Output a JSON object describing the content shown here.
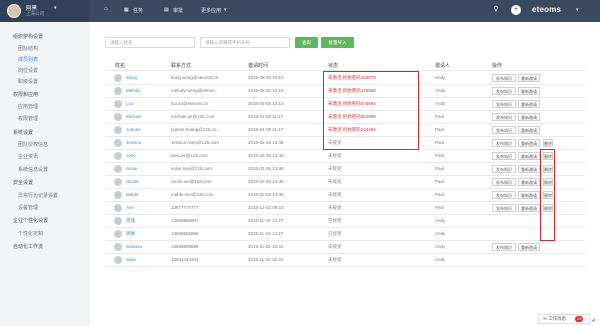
{
  "header": {
    "user_name": "阿黑",
    "user_company": "上海公司",
    "nav": [
      {
        "label": "任务"
      },
      {
        "label": "审批"
      },
      {
        "label": "更多应用"
      }
    ],
    "logo": "eteoms"
  },
  "sidebar": {
    "items": [
      {
        "label": "组织架构设置",
        "type": "group"
      },
      {
        "label": "团队结构",
        "type": "sub"
      },
      {
        "label": "成员列表",
        "type": "sub",
        "active": true
      },
      {
        "label": "岗位设置",
        "type": "sub"
      },
      {
        "label": "职级设置",
        "type": "sub"
      },
      {
        "label": "权限和应用",
        "type": "group"
      },
      {
        "label": "应用管理",
        "type": "sub"
      },
      {
        "label": "权限管理",
        "type": "sub"
      },
      {
        "label": "系统设置",
        "type": "group"
      },
      {
        "label": "团队授权信息",
        "type": "sub"
      },
      {
        "label": "企业资讯",
        "type": "sub"
      },
      {
        "label": "系统信息设置",
        "type": "sub"
      },
      {
        "label": "安全设置",
        "type": "group"
      },
      {
        "label": "异常行为记录设置",
        "type": "sub"
      },
      {
        "label": "设备管理",
        "type": "sub"
      },
      {
        "label": "企业个性化设置",
        "type": "group"
      },
      {
        "label": "个性化定制",
        "type": "sub"
      },
      {
        "label": "自动化工作流",
        "type": "group"
      }
    ]
  },
  "search": {
    "name_placeholder": "请输入姓名",
    "contact_placeholder": "请输入邮箱或手机号码",
    "query_label": "查询",
    "import_label": "批量导入"
  },
  "table": {
    "headers": [
      "姓名",
      "联系方式",
      "邀请时间",
      "状态",
      "邀请人",
      "操作"
    ],
    "rows": [
      {
        "name": "Xiang",
        "contact": "kung.xiang@eteoms.cn",
        "time": "2016-05-05 10:10",
        "status": "未激活",
        "code": "初始密码163878",
        "inviter": "Andy",
        "op1": "发布知识",
        "op2": "重新邀请"
      },
      {
        "name": "Melody",
        "contact": "melody.meng@eteom...",
        "time": "2016-05-05 10:10",
        "status": "未激活",
        "code": "初始密码475566",
        "inviter": "Andy",
        "op1": "发布知识",
        "op2": "重新邀请"
      },
      {
        "name": "Luo",
        "contact": "luo.xu@eteoms.cn",
        "time": "2016-05-05 10:10",
        "status": "未激活",
        "code": "初始密码675694",
        "inviter": "Andy",
        "op1": "发布知识",
        "op2": "重新邀请"
      },
      {
        "name": "Michael",
        "contact": "michael.ye@126.com",
        "time": "2016-04-08 11:17",
        "status": "未激活",
        "code": "初始密码551998",
        "inviter": "Paul",
        "op1": "发布知识",
        "op2": "重新邀请"
      },
      {
        "name": "Joanne",
        "contact": "joanne.huang@126.co...",
        "time": "2016-04-08 11:17",
        "status": "未激活",
        "code": "初始密码144484",
        "inviter": "Paul",
        "op1": "发布知识",
        "op2": "重新邀请"
      },
      {
        "name": "Jessica",
        "contact": "Jessica.chen@126.com",
        "time": "2016-02-26 13:48",
        "status": "未接受",
        "code": "",
        "inviter": "Paul",
        "op1": "发布知识",
        "op2": "重新邀请",
        "op3": "删除"
      },
      {
        "name": "Joey",
        "contact": "joey.xie@126.com",
        "time": "2016-02-26 13:48",
        "status": "未接受",
        "code": "",
        "inviter": "Paul",
        "op1": "发布知识",
        "op2": "重新邀请",
        "op3": "删除"
      },
      {
        "name": "Susie",
        "contact": "susie.mei@126.com",
        "time": "2016-02-26 13:48",
        "status": "未接受",
        "code": "",
        "inviter": "Paul",
        "op1": "发布知识",
        "op2": "重新邀请",
        "op3": "删除"
      },
      {
        "name": "Nicole",
        "contact": "nicole.xie@126.com",
        "time": "2016-02-26 13:48",
        "status": "未接受",
        "code": "",
        "inviter": "Paul",
        "op1": "发布知识",
        "op2": "重新邀请",
        "op3": "删除"
      },
      {
        "name": "Mable",
        "contact": "mable.mei@126.com",
        "time": "2016-02-26 13:48",
        "status": "未接受",
        "code": "",
        "inviter": "Paul",
        "op1": "发布知识",
        "op2": "重新邀请",
        "op3": "删除"
      },
      {
        "name": "Ann",
        "contact": "13677777777",
        "time": "2015-12-02 09:23",
        "status": "未接受",
        "code": "",
        "inviter": "Paul",
        "op1": "发布知识",
        "op2": "重新邀请",
        "op3": "删除"
      },
      {
        "name": "周理",
        "contact": "13566566667",
        "time": "2015-11-19 14:27",
        "status": "已接受",
        "code": "",
        "inviter": "Andy",
        "op1": "",
        "op2": ""
      },
      {
        "name": "周静",
        "contact": "13566566666",
        "time": "2015-11-19 14:27",
        "status": "已接受",
        "code": "",
        "inviter": "Andy",
        "op1": "",
        "op2": ""
      },
      {
        "name": "wwwww",
        "contact": "13588888888",
        "time": "2015-11-02 16:31",
        "status": "未接受",
        "code": "",
        "inviter": "Andy",
        "op1": "发布知识",
        "op2": "重新邀请"
      },
      {
        "name": "www",
        "contact": "13844444444",
        "time": "2015-11-02 16:31",
        "status": "未接受",
        "code": "",
        "inviter": "Andy",
        "op1": "",
        "op2": ""
      }
    ]
  },
  "footer": {
    "work_notice_label": "工作消息",
    "work_notice_count": "20"
  },
  "colors": {
    "topbar": "#3b4a60",
    "accent": "#3a8ee6",
    "button_green": "#5cb85c",
    "highlight_red": "#e52222"
  }
}
